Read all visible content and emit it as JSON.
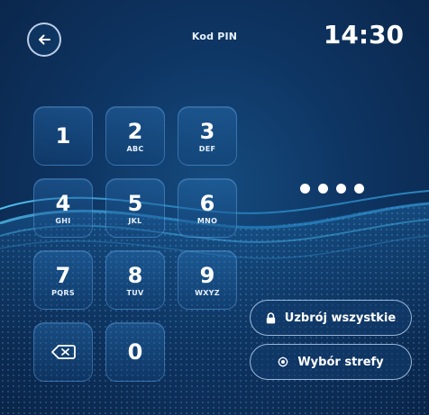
{
  "header": {
    "back_icon": "arrow-left-icon",
    "title": "Kod PIN",
    "time": "14:30"
  },
  "keypad": {
    "keys": [
      {
        "digit": "1",
        "letters": ""
      },
      {
        "digit": "2",
        "letters": "ABC"
      },
      {
        "digit": "3",
        "letters": "DEF"
      },
      {
        "digit": "4",
        "letters": "GHI"
      },
      {
        "digit": "5",
        "letters": "JKL"
      },
      {
        "digit": "6",
        "letters": "MNO"
      },
      {
        "digit": "7",
        "letters": "PQRS"
      },
      {
        "digit": "8",
        "letters": "TUV"
      },
      {
        "digit": "9",
        "letters": "WXYZ"
      }
    ],
    "backspace_icon": "backspace-icon",
    "zero": "0"
  },
  "pin": {
    "entered_length": 4
  },
  "actions": {
    "arm_all": {
      "label": "Uzbrój wszystkie",
      "icon": "lock-icon"
    },
    "zone_select": {
      "label": "Wybór strefy",
      "icon": "zone-icon"
    }
  },
  "colors": {
    "background": "#0e3563",
    "accent": "#6fc8ff",
    "text": "#ffffff"
  }
}
